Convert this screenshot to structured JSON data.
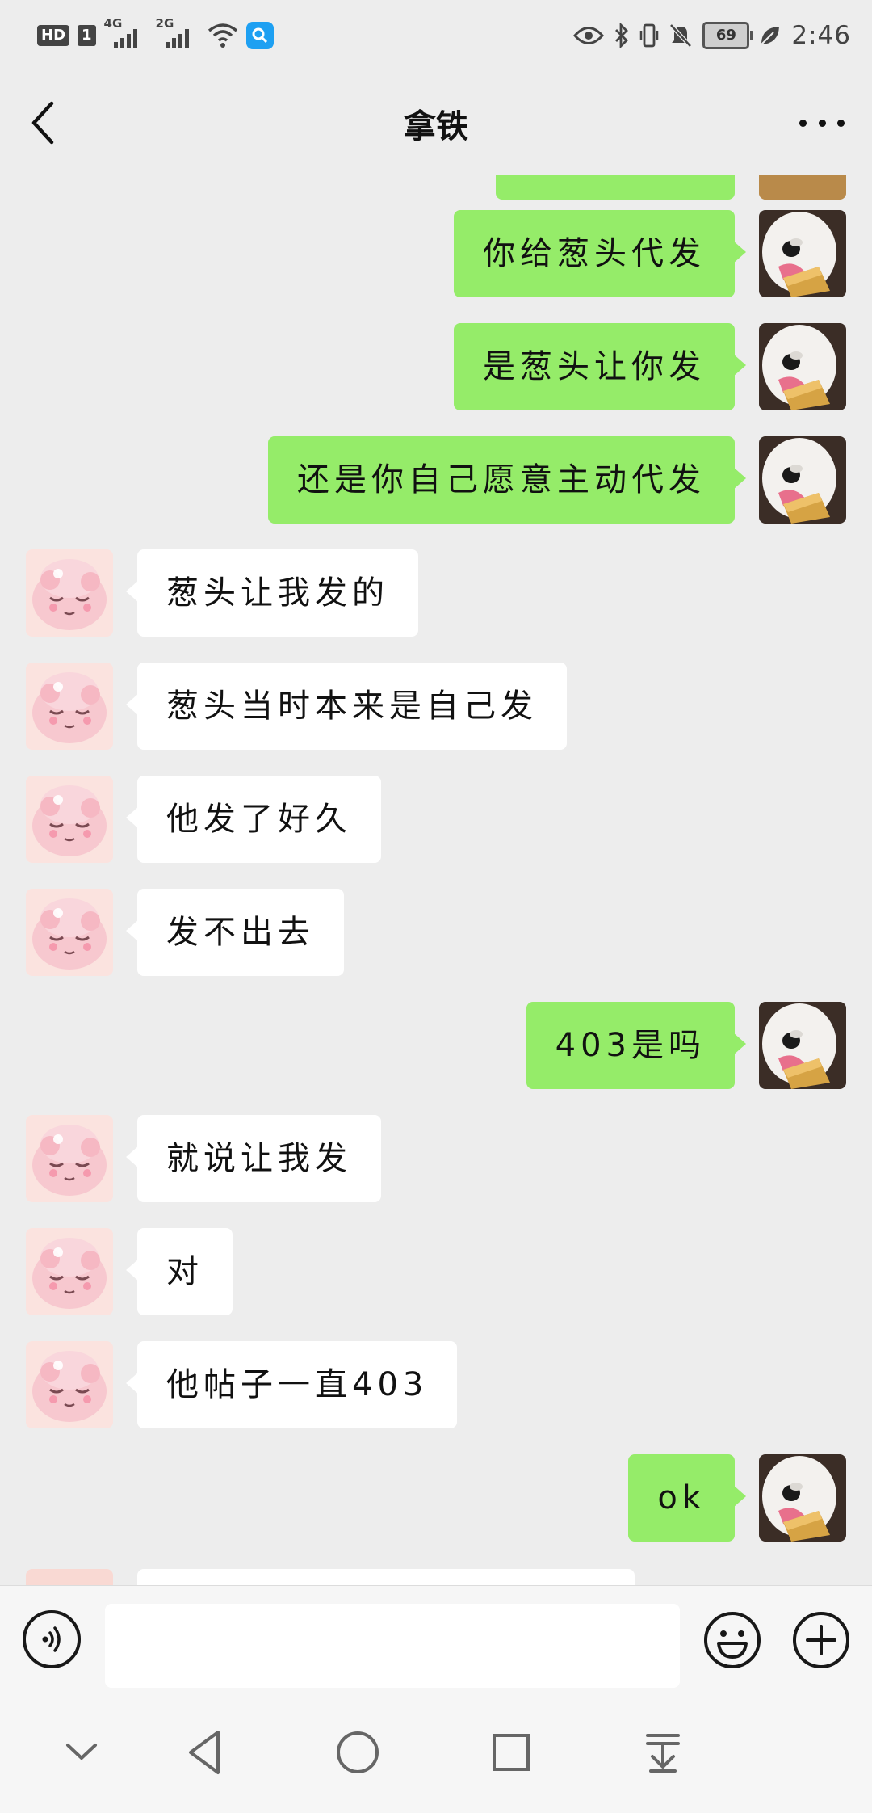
{
  "status_bar": {
    "hd_label": "HD",
    "sim_label": "1",
    "network_1": "4G",
    "network_2": "2G",
    "battery_level": "69",
    "time": "2:46"
  },
  "header": {
    "title": "拿铁",
    "back_icon": "chevron-left-icon",
    "more_icon": "more-dots-icon"
  },
  "messages": [
    {
      "side": "out",
      "text": "你给葱头代发"
    },
    {
      "side": "out",
      "text": "是葱头让你发"
    },
    {
      "side": "out",
      "text": "还是你自己愿意主动代发"
    },
    {
      "side": "in",
      "text": "葱头让我发的"
    },
    {
      "side": "in",
      "text": "葱头当时本来是自己发"
    },
    {
      "side": "in",
      "text": "他发了好久"
    },
    {
      "side": "in",
      "text": "发不出去"
    },
    {
      "side": "out",
      "text": "403是吗"
    },
    {
      "side": "in",
      "text": "就说让我发"
    },
    {
      "side": "in",
      "text": "对"
    },
    {
      "side": "in",
      "text": "他帖子一直403"
    },
    {
      "side": "out",
      "text": "ok"
    }
  ],
  "input_bar": {
    "placeholder": "",
    "voice_icon": "voice-icon",
    "emoji_icon": "emoji-icon",
    "plus_icon": "plus-icon"
  },
  "colors": {
    "outgoing_bubble": "#95ec69",
    "incoming_bubble": "#ffffff",
    "background": "#ededed"
  }
}
